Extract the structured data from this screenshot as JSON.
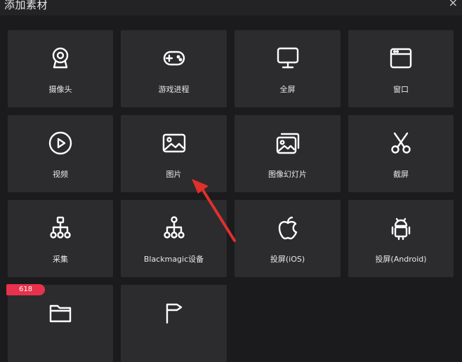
{
  "window": {
    "title": "添加素材",
    "close_glyph": "×"
  },
  "tiles": [
    {
      "label": "摄像头",
      "icon": "webcam-icon"
    },
    {
      "label": "游戏进程",
      "icon": "gamepad-icon"
    },
    {
      "label": "全屏",
      "icon": "monitor-icon"
    },
    {
      "label": "窗口",
      "icon": "window-icon"
    },
    {
      "label": "视频",
      "icon": "play-icon"
    },
    {
      "label": "图片",
      "icon": "image-icon"
    },
    {
      "label": "图像幻灯片",
      "icon": "slideshow-icon"
    },
    {
      "label": "截屏",
      "icon": "scissors-icon"
    },
    {
      "label": "采集",
      "icon": "capture-tree-icon"
    },
    {
      "label": "Blackmagic设备",
      "icon": "blackmagic-tree-icon"
    },
    {
      "label": "投屏(iOS)",
      "icon": "apple-icon"
    },
    {
      "label": "投屏(Android)",
      "icon": "android-icon"
    },
    {
      "label": "",
      "icon": "folder-icon",
      "badge": "618"
    },
    {
      "label": "",
      "icon": "flag-icon"
    }
  ],
  "colors": {
    "background": "#1b1b1d",
    "tile": "#2c2c2e",
    "badge": "#e8314c",
    "arrow": "#e0302c"
  }
}
